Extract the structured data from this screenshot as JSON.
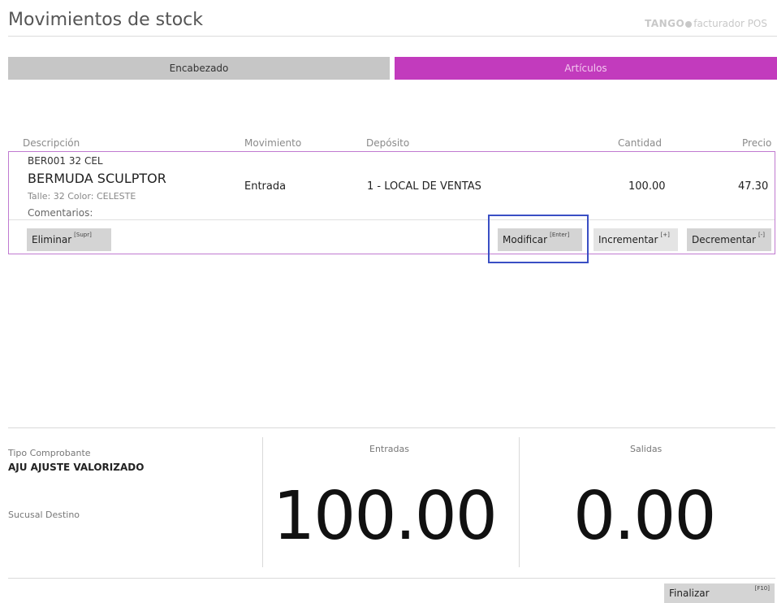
{
  "header": {
    "title": "Movimientos de stock",
    "brand_name": "TANGO",
    "brand_product": "facturador POS"
  },
  "tabs": [
    {
      "label": "Encabezado"
    },
    {
      "label": "Artículos"
    }
  ],
  "table": {
    "columns": {
      "descripcion": "Descripción",
      "movimiento": "Movimiento",
      "deposito": "Depósito",
      "cantidad": "Cantidad",
      "precio": "Precio"
    },
    "item": {
      "code": "BER001   32 CEL",
      "description": "BERMUDA SCULPTOR",
      "attributes": "Talle: 32  Color: CELESTE",
      "comments": "Comentarios:",
      "movimiento": "Entrada",
      "deposito": "1 - LOCAL DE VENTAS",
      "cantidad": "100.00",
      "precio": "47.30"
    },
    "buttons": {
      "eliminar": {
        "label": "Eliminar",
        "shortcut": "[Supr]"
      },
      "modificar": {
        "label": "Modificar",
        "shortcut": "[Enter]"
      },
      "incrementar": {
        "label": "Incrementar",
        "shortcut": "[+]"
      },
      "decrementar": {
        "label": "Decrementar",
        "shortcut": "[-]"
      }
    }
  },
  "summary": {
    "tipo_label": "Tipo Comprobante",
    "tipo_value": "AJU AJUSTE VALORIZADO",
    "sucursal_label": "Sucusal Destino",
    "entradas_label": "Entradas",
    "entradas_value": "100.00",
    "salidas_label": "Salidas",
    "salidas_value": "0.00"
  },
  "footer": {
    "finalizar": {
      "label": "Finalizar",
      "shortcut": "[F10]"
    }
  },
  "colors": {
    "accent": "#c23bbd",
    "focus": "#3a4fc4",
    "row_border": "#c07ad0"
  }
}
